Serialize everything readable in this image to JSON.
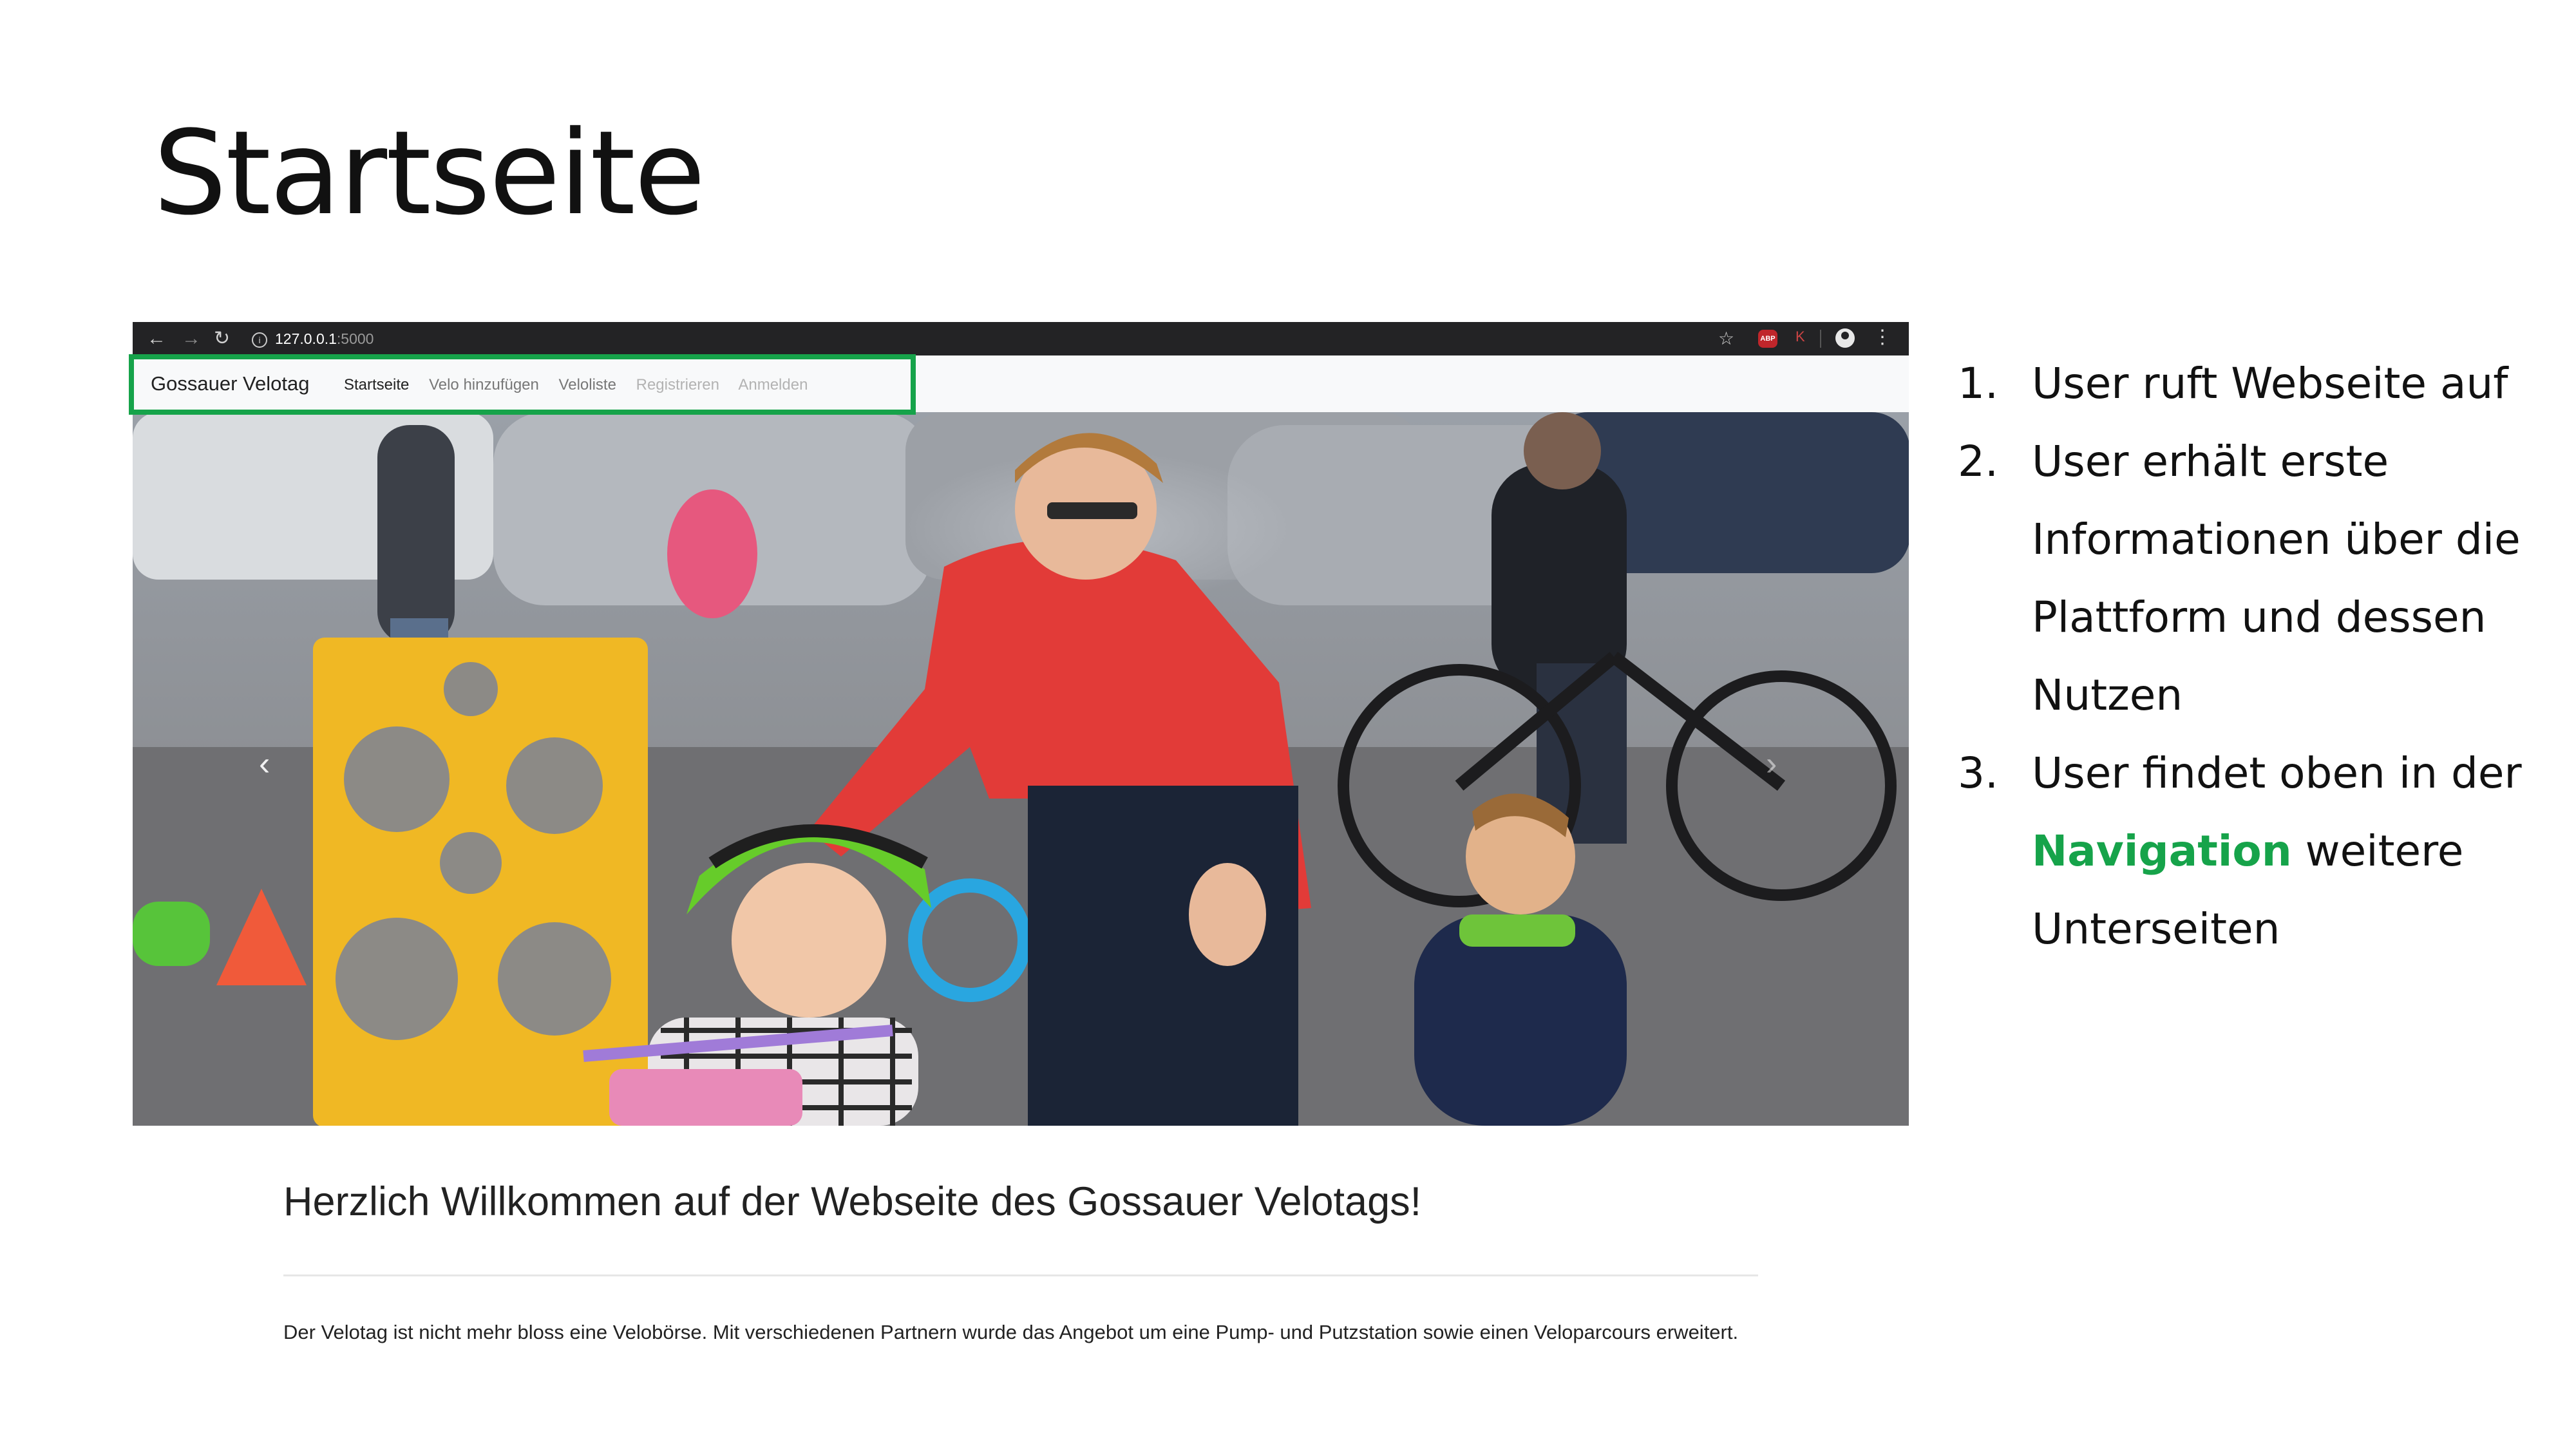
{
  "slide": {
    "title": "Startseite"
  },
  "browser": {
    "back_icon": "arrow-left-icon",
    "forward_icon": "arrow-right-icon",
    "reload_icon": "reload-icon",
    "url_host": "127.0.0.1",
    "url_port": ":5000",
    "star_icon": "star-icon",
    "menu_icon": "kebab-menu-icon"
  },
  "navbar": {
    "brand": "Gossauer Velotag",
    "links": [
      {
        "label": "Startseite",
        "state": "active"
      },
      {
        "label": "Velo hinzufügen",
        "state": "normal"
      },
      {
        "label": "Veloliste",
        "state": "normal"
      },
      {
        "label": "Registrieren",
        "state": "muted"
      },
      {
        "label": "Anmelden",
        "state": "muted"
      }
    ]
  },
  "carousel": {
    "prev_icon": "chevron-left-icon",
    "next_icon": "chevron-right-icon",
    "prev_glyph": "‹",
    "next_glyph": "›"
  },
  "page": {
    "heading": "Herzlich Willkommen auf der Webseite des Gossauer Velotags!",
    "text": "Der Velotag ist nicht mehr bloss eine Velobörse. Mit verschiedenen Partnern wurde das Angebot um eine Pump- und Putzstation sowie einen Veloparcours erweitert."
  },
  "steps": [
    {
      "num": "1.",
      "text": "User ruft Webseite auf"
    },
    {
      "num": "2.",
      "text": "User erhält erste Informationen über die Plattform und dessen Nutzen"
    },
    {
      "num": "3.",
      "text_before": "User findet oben in der ",
      "highlight": "Navigation",
      "text_after": " weitere Unterseiten"
    }
  ],
  "colors": {
    "highlight_green": "#16a34a",
    "chrome_bar": "#232325",
    "navbar_bg": "#f8f9fa"
  }
}
